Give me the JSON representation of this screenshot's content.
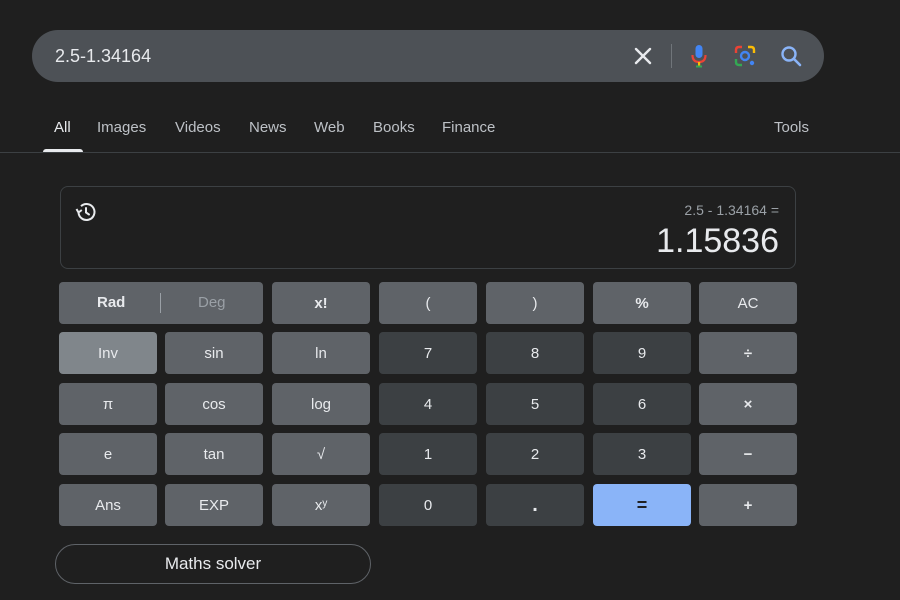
{
  "search": {
    "query": "2.5-1.34164"
  },
  "tabs": [
    {
      "label": "All",
      "active": true
    },
    {
      "label": "Images"
    },
    {
      "label": "Videos"
    },
    {
      "label": "News"
    },
    {
      "label": "Web"
    },
    {
      "label": "Books"
    },
    {
      "label": "Finance"
    }
  ],
  "tools_label": "Tools",
  "calculator": {
    "expression": "2.5 - 1.34164 =",
    "result": "1.15836",
    "mode": {
      "rad": "Rad",
      "deg": "Deg",
      "selected": "Rad"
    },
    "keys": {
      "fact": "x!",
      "lparen": "(",
      "rparen": ")",
      "percent": "%",
      "ac": "AC",
      "inv": "Inv",
      "sin": "sin",
      "ln": "ln",
      "seven": "7",
      "eight": "8",
      "nine": "9",
      "divide": "÷",
      "pi": "π",
      "cos": "cos",
      "log": "log",
      "four": "4",
      "five": "5",
      "six": "6",
      "multiply": "×",
      "e": "e",
      "tan": "tan",
      "sqrt": "√",
      "one": "1",
      "two": "2",
      "three": "3",
      "minus": "−",
      "ans": "Ans",
      "exp": "EXP",
      "pow": "xʸ",
      "zero": "0",
      "dot": ".",
      "equals": "=",
      "plus": "+"
    }
  },
  "solver_label": "Maths solver",
  "colors": {
    "background": "#1f1f1f",
    "search_bar": "#4d5156",
    "function_key": "#5f6368",
    "number_key": "#3c4043",
    "equals_key": "#8ab4f8"
  }
}
